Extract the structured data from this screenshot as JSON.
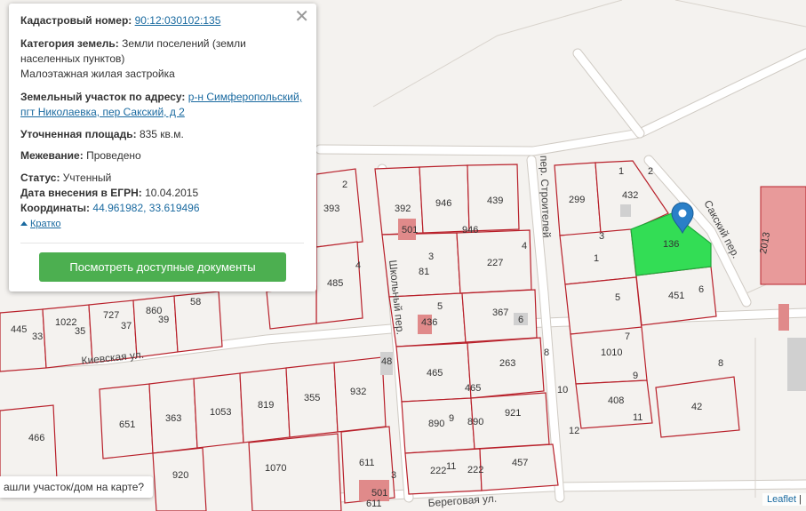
{
  "popup": {
    "cadastral_label": "Кадастровый номер:",
    "cadastral_value": "90:12:030102:135",
    "category_label": "Категория земель:",
    "category_value_1": "Земли поселений (земли",
    "category_value_2": "населенных пунктов)",
    "category_value_3": "Малоэтажная жилая застройка",
    "address_label": "Земельный участок по адресу:",
    "address_value_1": "р-н Симферопольский,",
    "address_value_2": "пгт Николаевка, пер Сакский, д 2",
    "area_label": "Уточненная площадь:",
    "area_value": "835 кв.м.",
    "survey_label": "Межевание:",
    "survey_value": "Проведено",
    "status_label": "Статус:",
    "status_value": "Учтенный",
    "egrn_label": "Дата внесения в ЕГРН:",
    "egrn_value": "10.04.2015",
    "coords_label": "Координаты:",
    "coords_value": "44.961982, 33.619496",
    "collapse_label": "Кратко",
    "close_glyph": "✕",
    "docs_button": "Посмотреть доступные документы"
  },
  "found_prompt": "ашли участок/дом на карте?",
  "attribution": {
    "leaflet": "Leaflet",
    "sep": "|"
  },
  "map": {
    "streets": {
      "stroiteley": "пер. Строителей",
      "sakskiy": "Сакский пер.",
      "shkolny": "Школьный пер.",
      "kievskaya": "Киевская ул.",
      "beregovaya": "Береговая ул."
    },
    "parcel_labels": [
      "2",
      "393",
      "4",
      "485",
      "392",
      "946",
      "439",
      "1",
      "432",
      "2",
      "299",
      "3",
      "136",
      "501",
      "946",
      "4",
      "3",
      "81",
      "227",
      "1",
      "6",
      "5",
      "451",
      "5",
      "436",
      "367",
      "6",
      "58",
      "860",
      "39",
      "37",
      "727",
      "1022",
      "35",
      "445",
      "33",
      "7",
      "1010",
      "465",
      "263",
      "48",
      "8",
      "465",
      "10",
      "9",
      "408",
      "42",
      "11",
      "890",
      "890",
      "921",
      "12",
      "932",
      "355",
      "819",
      "1053",
      "363",
      "651",
      "466",
      "920",
      "1070",
      "611",
      "222",
      "11",
      "222",
      "457",
      "3",
      "501",
      "611",
      "2013",
      "8",
      "9"
    ],
    "colors": {
      "selected_fill": "#33dd55",
      "parcel_border": "#b8202a",
      "building": "#e89a9a",
      "marker": "#2a7fc8",
      "button": "#4caf50"
    }
  }
}
